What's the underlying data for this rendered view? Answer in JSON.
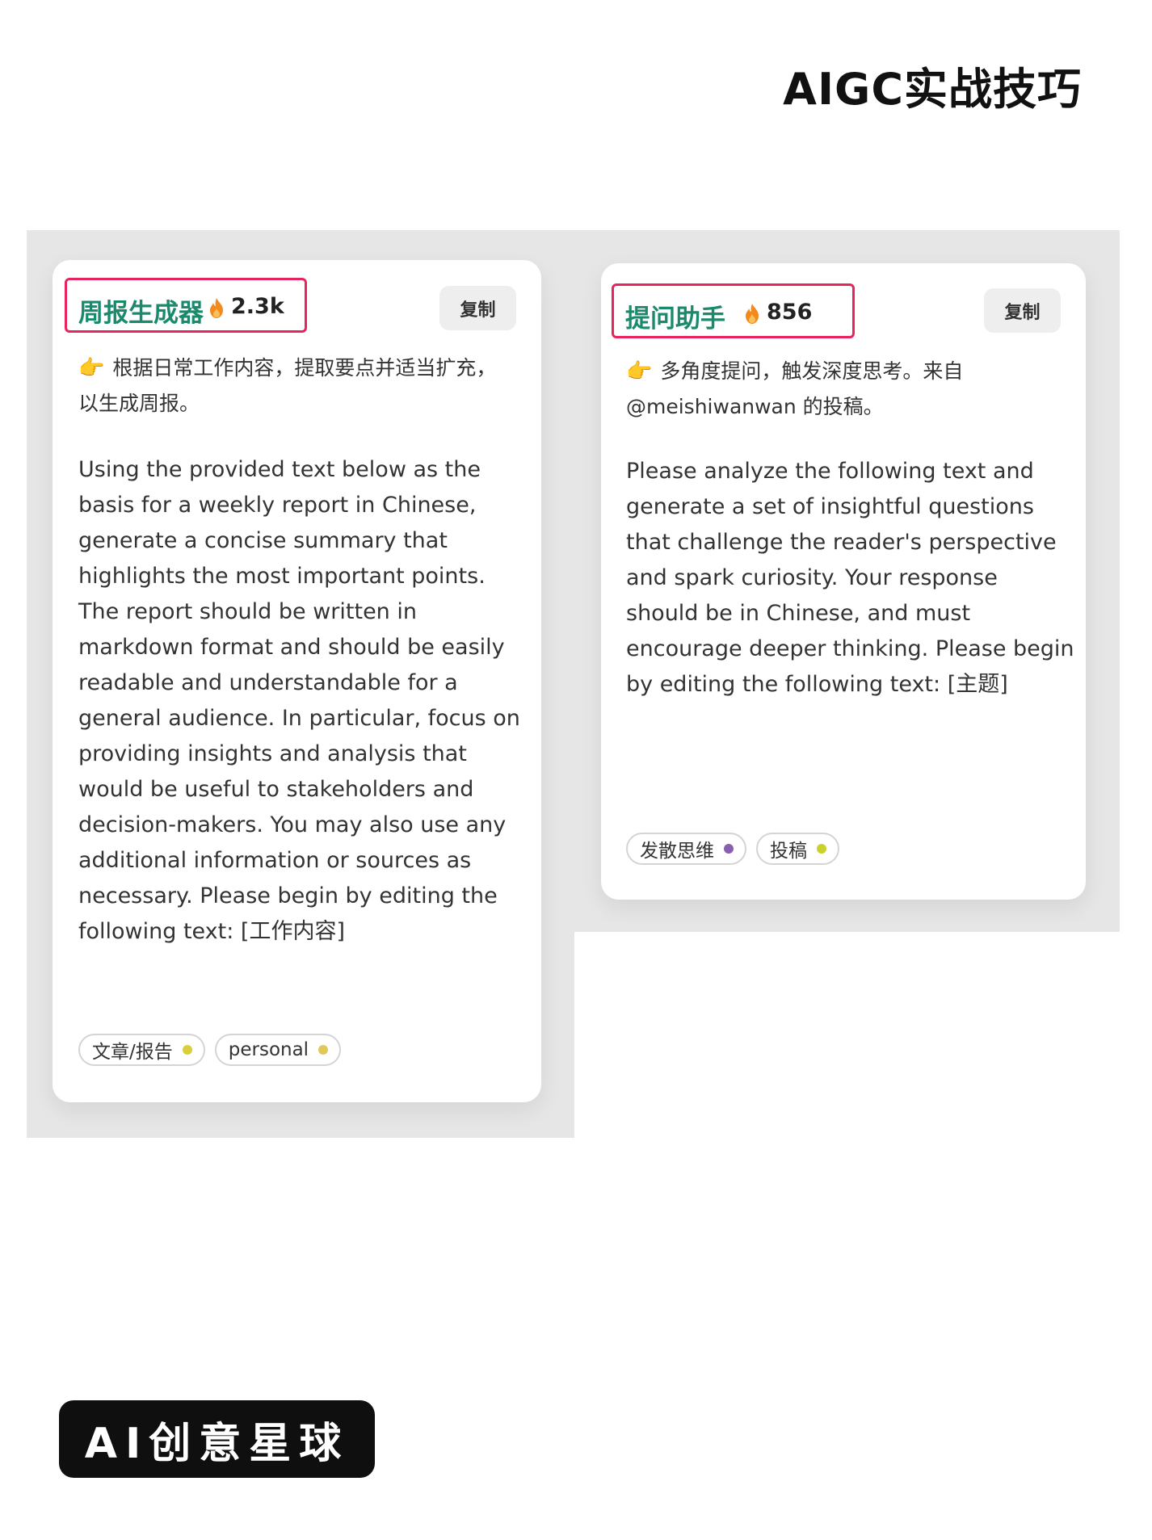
{
  "header": {
    "brand_title": "AIGC实战技巧"
  },
  "cards": [
    {
      "title": "周报生成器",
      "hot_count": "2.3k",
      "copy_label": "复制",
      "description": "根据日常工作内容，提取要点并适当扩充，以生成周报。",
      "prompt": "Using the provided text below as the basis for a weekly report in Chinese, generate a concise summary that highlights the most important points. The report should be written in markdown format and should be easily readable and understandable for a general audience. In particular, focus on providing insights and analysis that would be useful to stakeholders and decision-makers. You may also use any additional information or sources as necessary. Please begin by editing the following text: [工作内容]",
      "tags": [
        {
          "label": "文章/报告",
          "dot_color": "#d9cf3a"
        },
        {
          "label": "personal",
          "dot_color": "#e0c85a"
        }
      ]
    },
    {
      "title": "提问助手",
      "hot_count": "856",
      "copy_label": "复制",
      "description": "多角度提问，触发深度思考。来自 @meishiwanwan 的投稿。",
      "prompt": "Please analyze the following text and generate a set of insightful questions that challenge the reader's perspective and spark curiosity. Your response should be in Chinese, and must encourage deeper thinking. Please begin by editing the following text: [主题]",
      "tags": [
        {
          "label": "发散思维",
          "dot_color": "#8b5fb0"
        },
        {
          "label": "投稿",
          "dot_color": "#c9d12a"
        }
      ]
    }
  ],
  "footer": {
    "logo_text": "AI创意星球"
  },
  "colors": {
    "title_green": "#1a8a6d",
    "highlight_box": "#e8245e",
    "flame": "#f28a1e",
    "panel_bg": "#e6e6e6"
  },
  "icons": {
    "hot": "flame-icon",
    "pointer": "pointing-hand-icon",
    "tag_dot": "dot-icon"
  }
}
